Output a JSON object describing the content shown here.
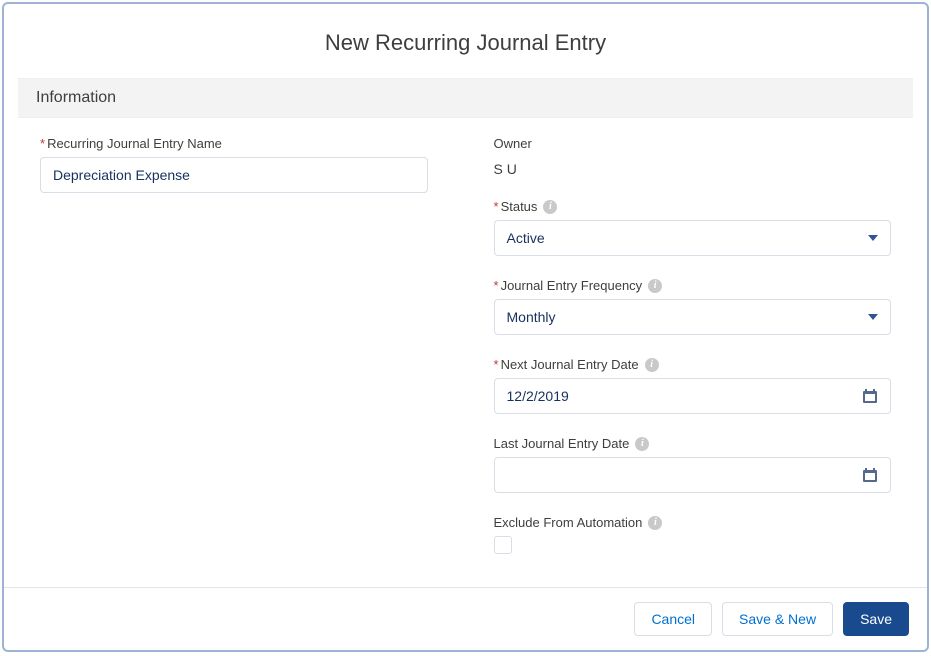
{
  "title": "New Recurring Journal Entry",
  "section_header": "Information",
  "left": {
    "name_label": "Recurring Journal Entry Name",
    "name_value": "Depreciation Expense"
  },
  "right": {
    "owner_label": "Owner",
    "owner_value": "S U",
    "status_label": "Status",
    "status_value": "Active",
    "frequency_label": "Journal Entry Frequency",
    "frequency_value": "Monthly",
    "next_date_label": "Next Journal Entry Date",
    "next_date_value": "12/2/2019",
    "last_date_label": "Last Journal Entry Date",
    "last_date_value": "",
    "exclude_label": "Exclude From Automation"
  },
  "footer": {
    "cancel": "Cancel",
    "save_new": "Save & New",
    "save": "Save"
  }
}
